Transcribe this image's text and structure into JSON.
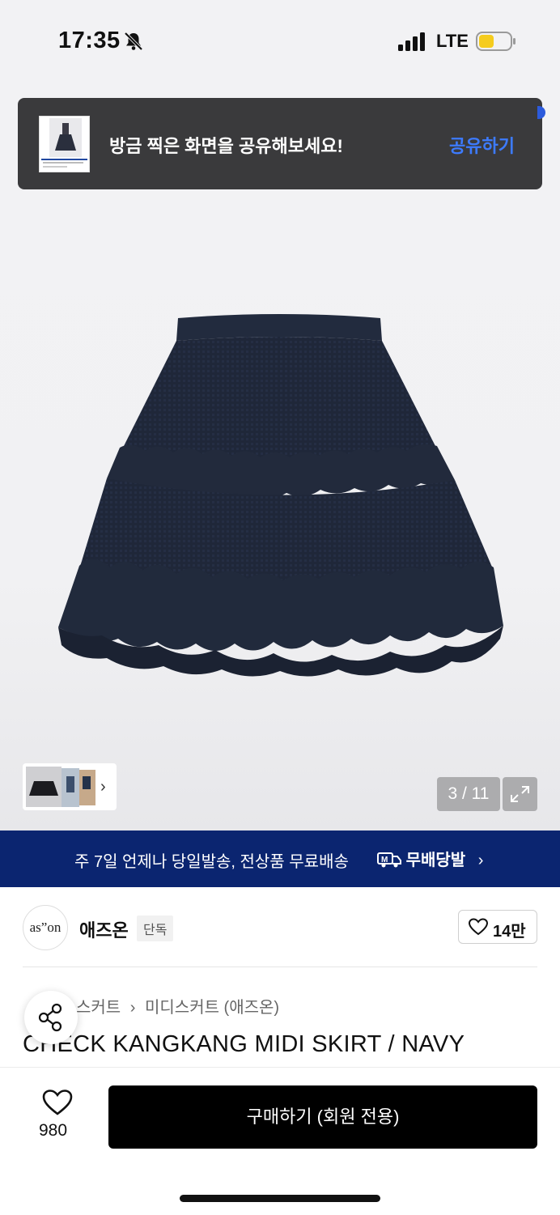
{
  "status_bar": {
    "time": "17:35",
    "network": "LTE"
  },
  "toast": {
    "message": "방금 찍은 화면을 공유해보세요!",
    "action": "공유하기"
  },
  "gallery": {
    "counter": "3 / 11"
  },
  "banner": {
    "text": "주 7일 언제나 당일발송, 전상품 무료배송",
    "service": "무배당발"
  },
  "brand": {
    "logo_text": "as”on",
    "name": "애즈온",
    "badge": "단독",
    "likes": "14만"
  },
  "breadcrumb": {
    "items": [
      "스커트",
      "미디스커트 (애즈온)"
    ],
    "separator": "›"
  },
  "product": {
    "title": "CHECK KANGKANG MIDI SKIRT / NAVY"
  },
  "bottom": {
    "wish_count": "980",
    "buy_label": "구매하기 (회원 전용)"
  },
  "colors": {
    "banner_bg": "#0b2570",
    "accent": "#3d7bff",
    "skirt": "#1e2638"
  }
}
